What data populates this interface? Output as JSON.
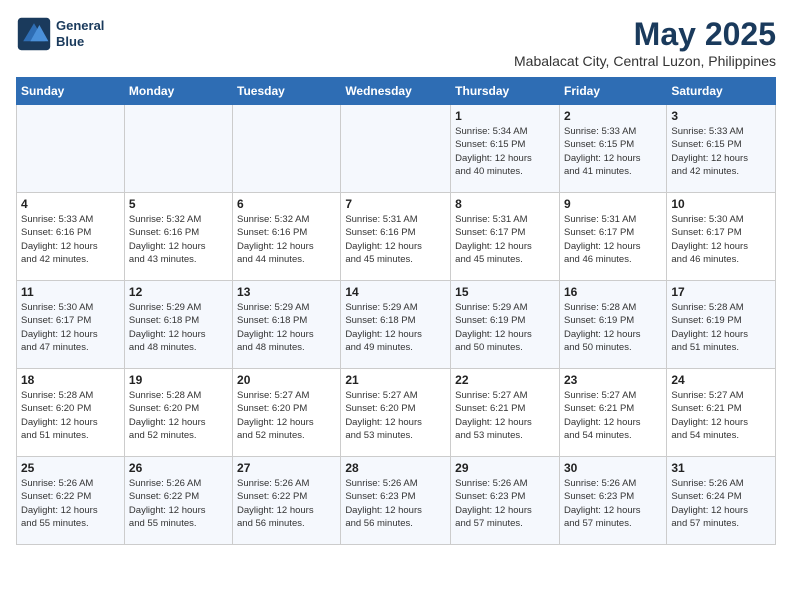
{
  "header": {
    "logo_line1": "General",
    "logo_line2": "Blue",
    "title": "May 2025",
    "subtitle": "Mabalacat City, Central Luzon, Philippines"
  },
  "days_of_week": [
    "Sunday",
    "Monday",
    "Tuesday",
    "Wednesday",
    "Thursday",
    "Friday",
    "Saturday"
  ],
  "weeks": [
    [
      {
        "num": "",
        "info": ""
      },
      {
        "num": "",
        "info": ""
      },
      {
        "num": "",
        "info": ""
      },
      {
        "num": "",
        "info": ""
      },
      {
        "num": "1",
        "info": "Sunrise: 5:34 AM\nSunset: 6:15 PM\nDaylight: 12 hours\nand 40 minutes."
      },
      {
        "num": "2",
        "info": "Sunrise: 5:33 AM\nSunset: 6:15 PM\nDaylight: 12 hours\nand 41 minutes."
      },
      {
        "num": "3",
        "info": "Sunrise: 5:33 AM\nSunset: 6:15 PM\nDaylight: 12 hours\nand 42 minutes."
      }
    ],
    [
      {
        "num": "4",
        "info": "Sunrise: 5:33 AM\nSunset: 6:16 PM\nDaylight: 12 hours\nand 42 minutes."
      },
      {
        "num": "5",
        "info": "Sunrise: 5:32 AM\nSunset: 6:16 PM\nDaylight: 12 hours\nand 43 minutes."
      },
      {
        "num": "6",
        "info": "Sunrise: 5:32 AM\nSunset: 6:16 PM\nDaylight: 12 hours\nand 44 minutes."
      },
      {
        "num": "7",
        "info": "Sunrise: 5:31 AM\nSunset: 6:16 PM\nDaylight: 12 hours\nand 45 minutes."
      },
      {
        "num": "8",
        "info": "Sunrise: 5:31 AM\nSunset: 6:17 PM\nDaylight: 12 hours\nand 45 minutes."
      },
      {
        "num": "9",
        "info": "Sunrise: 5:31 AM\nSunset: 6:17 PM\nDaylight: 12 hours\nand 46 minutes."
      },
      {
        "num": "10",
        "info": "Sunrise: 5:30 AM\nSunset: 6:17 PM\nDaylight: 12 hours\nand 46 minutes."
      }
    ],
    [
      {
        "num": "11",
        "info": "Sunrise: 5:30 AM\nSunset: 6:17 PM\nDaylight: 12 hours\nand 47 minutes."
      },
      {
        "num": "12",
        "info": "Sunrise: 5:29 AM\nSunset: 6:18 PM\nDaylight: 12 hours\nand 48 minutes."
      },
      {
        "num": "13",
        "info": "Sunrise: 5:29 AM\nSunset: 6:18 PM\nDaylight: 12 hours\nand 48 minutes."
      },
      {
        "num": "14",
        "info": "Sunrise: 5:29 AM\nSunset: 6:18 PM\nDaylight: 12 hours\nand 49 minutes."
      },
      {
        "num": "15",
        "info": "Sunrise: 5:29 AM\nSunset: 6:19 PM\nDaylight: 12 hours\nand 50 minutes."
      },
      {
        "num": "16",
        "info": "Sunrise: 5:28 AM\nSunset: 6:19 PM\nDaylight: 12 hours\nand 50 minutes."
      },
      {
        "num": "17",
        "info": "Sunrise: 5:28 AM\nSunset: 6:19 PM\nDaylight: 12 hours\nand 51 minutes."
      }
    ],
    [
      {
        "num": "18",
        "info": "Sunrise: 5:28 AM\nSunset: 6:20 PM\nDaylight: 12 hours\nand 51 minutes."
      },
      {
        "num": "19",
        "info": "Sunrise: 5:28 AM\nSunset: 6:20 PM\nDaylight: 12 hours\nand 52 minutes."
      },
      {
        "num": "20",
        "info": "Sunrise: 5:27 AM\nSunset: 6:20 PM\nDaylight: 12 hours\nand 52 minutes."
      },
      {
        "num": "21",
        "info": "Sunrise: 5:27 AM\nSunset: 6:20 PM\nDaylight: 12 hours\nand 53 minutes."
      },
      {
        "num": "22",
        "info": "Sunrise: 5:27 AM\nSunset: 6:21 PM\nDaylight: 12 hours\nand 53 minutes."
      },
      {
        "num": "23",
        "info": "Sunrise: 5:27 AM\nSunset: 6:21 PM\nDaylight: 12 hours\nand 54 minutes."
      },
      {
        "num": "24",
        "info": "Sunrise: 5:27 AM\nSunset: 6:21 PM\nDaylight: 12 hours\nand 54 minutes."
      }
    ],
    [
      {
        "num": "25",
        "info": "Sunrise: 5:26 AM\nSunset: 6:22 PM\nDaylight: 12 hours\nand 55 minutes."
      },
      {
        "num": "26",
        "info": "Sunrise: 5:26 AM\nSunset: 6:22 PM\nDaylight: 12 hours\nand 55 minutes."
      },
      {
        "num": "27",
        "info": "Sunrise: 5:26 AM\nSunset: 6:22 PM\nDaylight: 12 hours\nand 56 minutes."
      },
      {
        "num": "28",
        "info": "Sunrise: 5:26 AM\nSunset: 6:23 PM\nDaylight: 12 hours\nand 56 minutes."
      },
      {
        "num": "29",
        "info": "Sunrise: 5:26 AM\nSunset: 6:23 PM\nDaylight: 12 hours\nand 57 minutes."
      },
      {
        "num": "30",
        "info": "Sunrise: 5:26 AM\nSunset: 6:23 PM\nDaylight: 12 hours\nand 57 minutes."
      },
      {
        "num": "31",
        "info": "Sunrise: 5:26 AM\nSunset: 6:24 PM\nDaylight: 12 hours\nand 57 minutes."
      }
    ]
  ]
}
